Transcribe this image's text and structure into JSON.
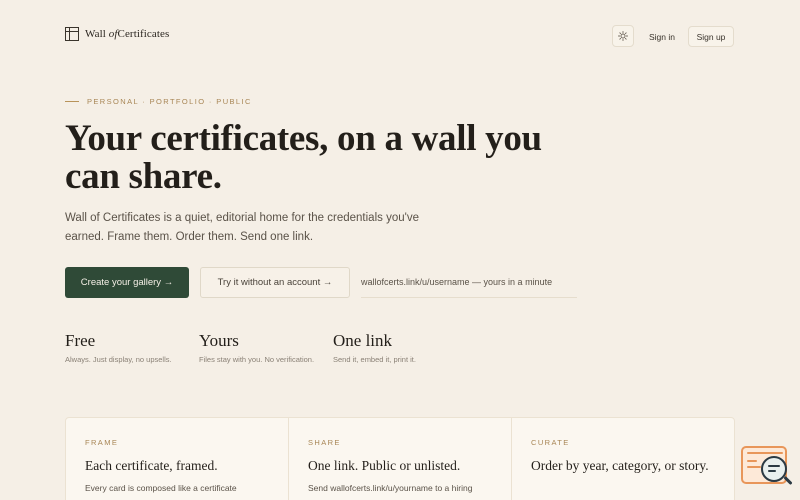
{
  "header": {
    "brand_prefix": "Wall ",
    "brand_of": "of",
    "brand_suffix": "Certificates",
    "theme_icon": "sun-icon",
    "signin_label": "Sign in",
    "signup_label": "Sign up"
  },
  "hero": {
    "eyebrow": "PERSONAL · PORTFOLIO · PUBLIC",
    "title": "Your certificates, on a wall you can share.",
    "subtitle": "Wall of Certificates is a quiet, editorial home for the credentials you've earned. Frame them. Order them. Send one link.",
    "primary_cta": "Create your gallery →",
    "secondary_cta": "Try it without an account →",
    "url_hint": "wallofcerts.link/u/username — yours in a minute"
  },
  "features": [
    {
      "title": "Free",
      "desc": "Always. Just display, no upsells."
    },
    {
      "title": "Yours",
      "desc": "Files stay with you. No verification."
    },
    {
      "title": "One link",
      "desc": "Send it, embed it, print it."
    }
  ],
  "cards": [
    {
      "eyebrow": "FRAME",
      "title": "Each certificate, framed.",
      "text": "Every card is composed like a certificate"
    },
    {
      "eyebrow": "SHARE",
      "title": "One link. Public or unlisted.",
      "text": "Send wallofcerts.link/u/yourname to a hiring"
    },
    {
      "eyebrow": "CURATE",
      "title": "Order by year, category, or story.",
      "text": ""
    }
  ],
  "colors": {
    "background": "#f5efe6",
    "accent_green": "#2f4a37",
    "eyebrow_gold": "#a88655",
    "widget_orange": "#e8965a"
  }
}
